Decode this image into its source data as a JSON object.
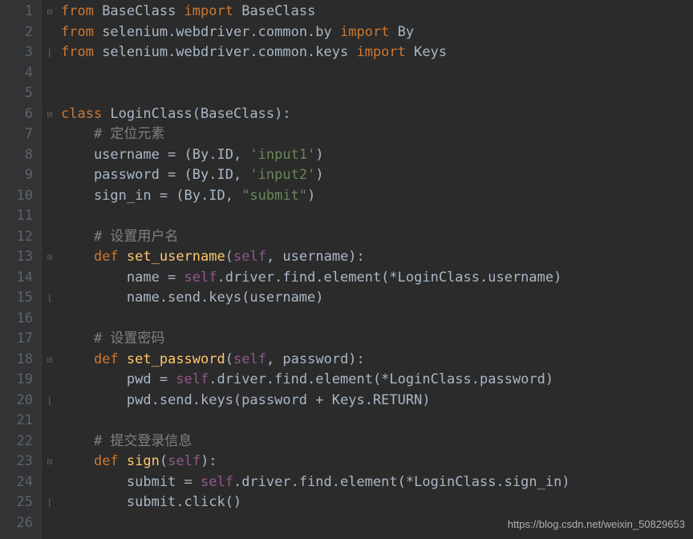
{
  "watermark": "https://blog.csdn.net/weixin_50829653",
  "lines": [
    {
      "n": "1",
      "fold": "open",
      "tokens": [
        {
          "c": "kw",
          "t": "from "
        },
        {
          "c": "",
          "t": "BaseClass "
        },
        {
          "c": "kw",
          "t": "import "
        },
        {
          "c": "",
          "t": "BaseClass"
        }
      ]
    },
    {
      "n": "2",
      "fold": "",
      "tokens": [
        {
          "c": "kw",
          "t": "from "
        },
        {
          "c": "",
          "t": "selenium.webdriver.common.by "
        },
        {
          "c": "kw",
          "t": "import "
        },
        {
          "c": "",
          "t": "By"
        }
      ]
    },
    {
      "n": "3",
      "fold": "close",
      "tokens": [
        {
          "c": "kw",
          "t": "from "
        },
        {
          "c": "",
          "t": "selenium.webdriver.common.keys "
        },
        {
          "c": "kw",
          "t": "import "
        },
        {
          "c": "",
          "t": "Keys"
        }
      ]
    },
    {
      "n": "4",
      "fold": "",
      "tokens": []
    },
    {
      "n": "5",
      "fold": "",
      "tokens": []
    },
    {
      "n": "6",
      "fold": "open",
      "tokens": [
        {
          "c": "kw",
          "t": "class "
        },
        {
          "c": "",
          "t": "LoginClass(BaseClass):"
        }
      ]
    },
    {
      "n": "7",
      "fold": "",
      "tokens": [
        {
          "c": "",
          "t": "    "
        },
        {
          "c": "cmt",
          "t": "# 定位元素"
        }
      ]
    },
    {
      "n": "8",
      "fold": "",
      "tokens": [
        {
          "c": "",
          "t": "    username = (By.ID"
        },
        {
          "c": "op",
          "t": ", "
        },
        {
          "c": "str",
          "t": "'input1'"
        },
        {
          "c": "",
          "t": ")"
        }
      ]
    },
    {
      "n": "9",
      "fold": "",
      "tokens": [
        {
          "c": "",
          "t": "    password = (By.ID"
        },
        {
          "c": "op",
          "t": ", "
        },
        {
          "c": "str",
          "t": "'input2'"
        },
        {
          "c": "",
          "t": ")"
        }
      ]
    },
    {
      "n": "10",
      "fold": "",
      "tokens": [
        {
          "c": "",
          "t": "    sign_in = (By.ID"
        },
        {
          "c": "op",
          "t": ", "
        },
        {
          "c": "str",
          "t": "\"submit\""
        },
        {
          "c": "",
          "t": ")"
        }
      ]
    },
    {
      "n": "11",
      "fold": "",
      "tokens": []
    },
    {
      "n": "12",
      "fold": "",
      "tokens": [
        {
          "c": "",
          "t": "    "
        },
        {
          "c": "cmt",
          "t": "# 设置用户名"
        }
      ]
    },
    {
      "n": "13",
      "fold": "open",
      "tokens": [
        {
          "c": "",
          "t": "    "
        },
        {
          "c": "kw",
          "t": "def "
        },
        {
          "c": "fn",
          "t": "set_username"
        },
        {
          "c": "",
          "t": "("
        },
        {
          "c": "self",
          "t": "self"
        },
        {
          "c": "op",
          "t": ", "
        },
        {
          "c": "",
          "t": "username):"
        }
      ]
    },
    {
      "n": "14",
      "fold": "",
      "tokens": [
        {
          "c": "",
          "t": "        name = "
        },
        {
          "c": "self",
          "t": "self"
        },
        {
          "c": "",
          "t": ".driver.find.element(*LoginClass.username)"
        }
      ]
    },
    {
      "n": "15",
      "fold": "close",
      "tokens": [
        {
          "c": "",
          "t": "        name.send.keys(username)"
        }
      ]
    },
    {
      "n": "16",
      "fold": "",
      "tokens": []
    },
    {
      "n": "17",
      "fold": "",
      "tokens": [
        {
          "c": "",
          "t": "    "
        },
        {
          "c": "cmt",
          "t": "# 设置密码"
        }
      ]
    },
    {
      "n": "18",
      "fold": "open",
      "tokens": [
        {
          "c": "",
          "t": "    "
        },
        {
          "c": "kw",
          "t": "def "
        },
        {
          "c": "fn",
          "t": "set_password"
        },
        {
          "c": "",
          "t": "("
        },
        {
          "c": "self",
          "t": "self"
        },
        {
          "c": "op",
          "t": ", "
        },
        {
          "c": "",
          "t": "password):"
        }
      ]
    },
    {
      "n": "19",
      "fold": "",
      "tokens": [
        {
          "c": "",
          "t": "        pwd = "
        },
        {
          "c": "self",
          "t": "self"
        },
        {
          "c": "",
          "t": ".driver.find.element(*LoginClass.password)"
        }
      ]
    },
    {
      "n": "20",
      "fold": "close",
      "tokens": [
        {
          "c": "",
          "t": "        pwd.send.keys(password + Keys.RETURN)"
        }
      ]
    },
    {
      "n": "21",
      "fold": "",
      "tokens": []
    },
    {
      "n": "22",
      "fold": "",
      "tokens": [
        {
          "c": "",
          "t": "    "
        },
        {
          "c": "cmt",
          "t": "# 提交登录信息"
        }
      ]
    },
    {
      "n": "23",
      "fold": "open",
      "tokens": [
        {
          "c": "",
          "t": "    "
        },
        {
          "c": "kw",
          "t": "def "
        },
        {
          "c": "fn",
          "t": "sign"
        },
        {
          "c": "",
          "t": "("
        },
        {
          "c": "self",
          "t": "self"
        },
        {
          "c": "",
          "t": "):"
        }
      ]
    },
    {
      "n": "24",
      "fold": "",
      "tokens": [
        {
          "c": "",
          "t": "        submit = "
        },
        {
          "c": "self",
          "t": "self"
        },
        {
          "c": "",
          "t": ".driver.find.element(*LoginClass.sign_in)"
        }
      ]
    },
    {
      "n": "25",
      "fold": "close",
      "tokens": [
        {
          "c": "",
          "t": "        submit.click()"
        }
      ]
    },
    {
      "n": "26",
      "fold": "",
      "tokens": []
    }
  ]
}
